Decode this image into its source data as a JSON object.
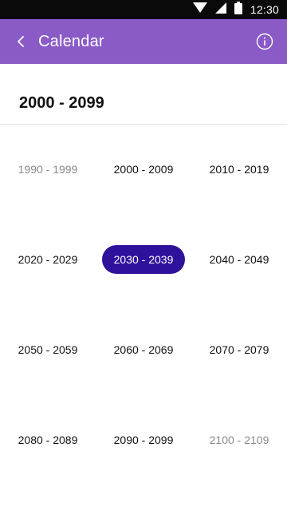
{
  "status_bar": {
    "time": "12:30",
    "icons": [
      "wifi-icon",
      "signal-icon",
      "battery-icon"
    ]
  },
  "app_bar": {
    "title": "Calendar",
    "back_icon": "chevron-left-icon",
    "info_icon": "info-icon",
    "background_color": "#8a5ac7"
  },
  "range_header": {
    "title": "2000 - 2099"
  },
  "decade_grid": {
    "selected_color": "#2f129c",
    "rows": [
      [
        {
          "label": "1990 - 1999",
          "state": "dim"
        },
        {
          "label": "2000 - 2009",
          "state": "normal"
        },
        {
          "label": "2010 - 2019",
          "state": "normal"
        }
      ],
      [
        {
          "label": "2020 - 2029",
          "state": "normal"
        },
        {
          "label": "2030 - 2039",
          "state": "selected"
        },
        {
          "label": "2040 - 2049",
          "state": "normal"
        }
      ],
      [
        {
          "label": "2050 - 2059",
          "state": "normal"
        },
        {
          "label": "2060 - 2069",
          "state": "normal"
        },
        {
          "label": "2070 - 2079",
          "state": "normal"
        }
      ],
      [
        {
          "label": "2080 - 2089",
          "state": "normal"
        },
        {
          "label": "2090 - 2099",
          "state": "normal"
        },
        {
          "label": "2100 - 2109",
          "state": "dim"
        }
      ]
    ]
  }
}
